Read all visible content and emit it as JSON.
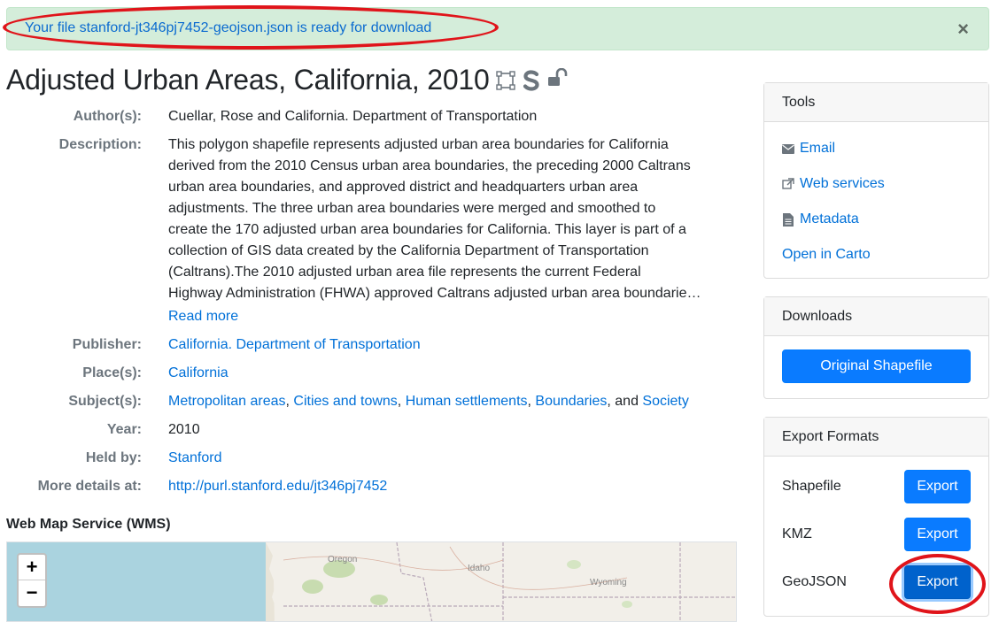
{
  "alert": {
    "message": "Your file stanford-jt346pj7452-geojson.json is ready for download",
    "close": "×"
  },
  "title": "Adjusted Urban Areas, California, 2010",
  "metadata": {
    "authors_label": "Author(s):",
    "authors": "Cuellar, Rose and California. Department of Transportation",
    "description_label": "Description:",
    "description_lines": [
      "This polygon shapefile represents adjusted urban area boundaries for California",
      "derived from the 2010 Census urban area boundaries, the preceding 2000 Caltrans",
      "urban area boundaries, and approved district and headquarters urban area",
      "adjustments. The three urban area boundaries were merged and smoothed to",
      "create the 170 adjusted urban area boundaries for California. This layer is part of a",
      "collection of GIS data created by the California Department of Transportation",
      "(Caltrans).The 2010 adjusted urban area file represents the current Federal",
      "Highway Administration (FHWA) approved Caltrans adjusted urban area boundarie…"
    ],
    "read_more": "Read more",
    "publisher_label": "Publisher:",
    "publisher": "California. Department of Transportation",
    "places_label": "Place(s):",
    "place": "California",
    "subjects_label": "Subject(s):",
    "subjects": [
      "Metropolitan areas",
      "Cities and towns",
      "Human settlements",
      "Boundaries",
      "Society"
    ],
    "subjects_sep": ", ",
    "subjects_and": ", and ",
    "year_label": "Year:",
    "year": "2010",
    "held_by_label": "Held by:",
    "held_by": "Stanford",
    "more_details_label": "More details at:",
    "more_details": "http://purl.stanford.edu/jt346pj7452"
  },
  "wms": {
    "title": "Web Map Service (WMS)",
    "zoom_in": "+",
    "zoom_out": "−",
    "labels": [
      "Oregon",
      "Idaho",
      "Wyoming"
    ]
  },
  "tools": {
    "header": "Tools",
    "items": [
      {
        "label": "Email",
        "icon": "envelope-icon"
      },
      {
        "label": "Web services",
        "icon": "external-link-icon"
      },
      {
        "label": "Metadata",
        "icon": "file-icon"
      },
      {
        "label": "Open in Carto",
        "icon": ""
      }
    ]
  },
  "downloads": {
    "header": "Downloads",
    "button": "Original Shapefile"
  },
  "export": {
    "header": "Export Formats",
    "rows": [
      {
        "format": "Shapefile",
        "button": "Export"
      },
      {
        "format": "KMZ",
        "button": "Export"
      },
      {
        "format": "GeoJSON",
        "button": "Export"
      }
    ]
  },
  "colors": {
    "accent": "#0a7bff",
    "link": "#0070d8",
    "alert_bg": "#d4edda",
    "annotation": "#e0141a"
  }
}
